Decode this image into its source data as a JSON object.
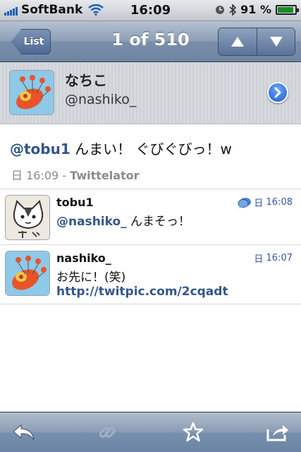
{
  "status_bar": {
    "carrier": "SoftBank",
    "time": "16:09",
    "battery_text": "91 %",
    "battery_level": 0.91
  },
  "nav": {
    "back_label": "List",
    "title": "1 of 510"
  },
  "profile": {
    "name": "なちこ",
    "handle": "@nashiko_"
  },
  "tweet": {
    "mention": "@tobu1",
    "text": " んまい！ ぐびぐびっ！w",
    "day": "日",
    "time": "16:09",
    "separator": " - ",
    "source": "Twittelator"
  },
  "replies": [
    {
      "name": "tobu1",
      "day": "日",
      "time": "16:08",
      "mention": "@nashiko_",
      "text": " んまそっ！",
      "link": ""
    },
    {
      "name": "nashiko_",
      "day": "日",
      "time": "16:07",
      "mention": "",
      "text": "お先に！(笑)",
      "link": "http://twitpic.com/2cqadt"
    }
  ],
  "colors": {
    "link": "#34568b",
    "timestamp": "#3556a0",
    "nav_bar": "#7a8ea9"
  }
}
